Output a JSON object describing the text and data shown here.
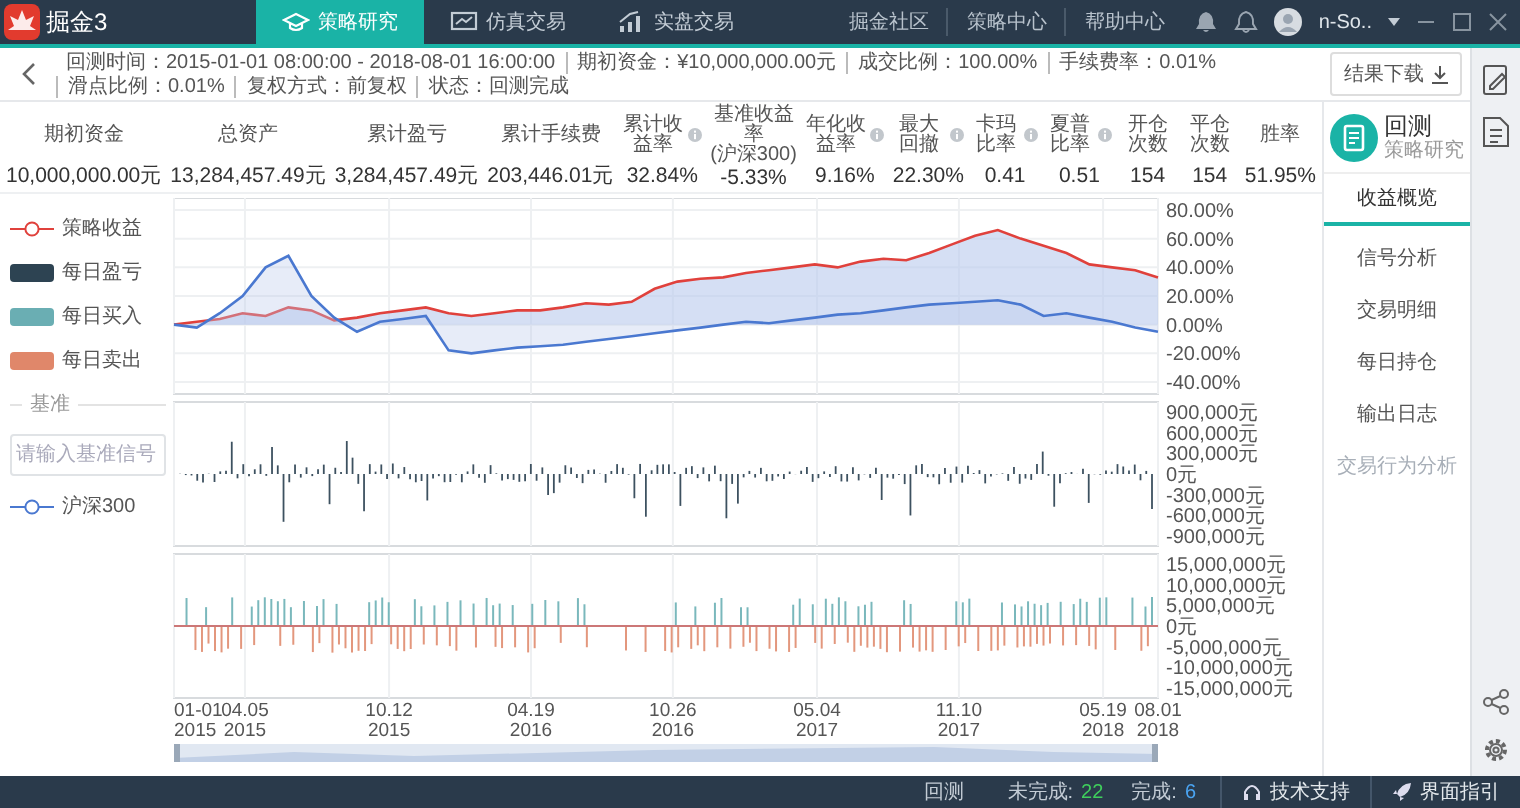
{
  "app": {
    "name": "掘金3"
  },
  "nav_tabs": [
    {
      "label": "策略研究",
      "selected": true
    },
    {
      "label": "仿真交易",
      "selected": false
    },
    {
      "label": "实盘交易",
      "selected": false
    }
  ],
  "header_links": [
    "掘金社区",
    "策略中心",
    "帮助中心"
  ],
  "user": {
    "name": "n-So.."
  },
  "info_bar": {
    "items": [
      "回测时间：2015-01-01 08:00:00 - 2018-08-01 16:00:00",
      "期初资金：¥10,000,000.00元",
      "成交比例：100.00%",
      "手续费率：0.01%",
      "滑点比例：0.01%",
      "复权方式：前复权",
      "状态：回测完成"
    ],
    "download_button": "结果下载"
  },
  "stats": [
    {
      "label": "期初资金",
      "value": "10,000,000.00元",
      "info": false
    },
    {
      "label": "总资产",
      "value": "13,284,457.49元",
      "info": false
    },
    {
      "label": "累计盈亏",
      "value": "3,284,457.49元",
      "info": false
    },
    {
      "label": "累计手续费",
      "value": "203,446.01元",
      "info": false
    },
    {
      "label": "累计收益率",
      "value": "32.84%",
      "info": true
    },
    {
      "label": "基准收益率",
      "sublabel": "(沪深300)",
      "value": "-5.33%",
      "info": false
    },
    {
      "label": "年化收益率",
      "value": "9.16%",
      "info": true
    },
    {
      "label": "最大回撤",
      "value": "22.30%",
      "info": true
    },
    {
      "label": "卡玛比率",
      "value": "0.41",
      "info": true
    },
    {
      "label": "夏普比率",
      "value": "0.51",
      "info": true
    },
    {
      "label": "开仓次数",
      "value": "154",
      "info": false
    },
    {
      "label": "平仓次数",
      "value": "154",
      "info": false
    },
    {
      "label": "胜率",
      "value": "51.95%",
      "info": false
    }
  ],
  "legend": {
    "items": [
      {
        "kind": "line",
        "label": "策略收益",
        "color": "#e0413c"
      },
      {
        "kind": "swatch",
        "label": "每日盈亏",
        "color": "#2d4352"
      },
      {
        "kind": "swatch",
        "label": "每日买入",
        "color": "#6aaeb3"
      },
      {
        "kind": "swatch",
        "label": "每日卖出",
        "color": "#e0876a"
      }
    ],
    "benchmark_heading": "基准",
    "benchmark_placeholder": "请输入基准信号",
    "benchmark_items": [
      {
        "kind": "line",
        "label": "沪深300",
        "color": "#4a78d0"
      }
    ]
  },
  "charts": {
    "returns": {
      "chart_data": {
        "type": "line",
        "ylim": [
          -40,
          80
        ],
        "grid": true,
        "yticks": [
          {
            "value": 80,
            "label": "80.00%"
          },
          {
            "value": 60,
            "label": "60.00%"
          },
          {
            "value": 40,
            "label": "40.00%"
          },
          {
            "value": 20,
            "label": "20.00%"
          },
          {
            "value": 0,
            "label": "0.00%"
          },
          {
            "value": -20,
            "label": "-20.00%"
          },
          {
            "value": -40,
            "label": "-40.00%"
          }
        ],
        "series": [
          {
            "color": "#e0413c",
            "values": [
              0,
              2,
              4,
              8,
              6,
              12,
              10,
              3,
              5,
              8,
              10,
              12,
              8,
              6,
              8,
              10,
              10,
              12,
              15,
              14,
              16,
              25,
              30,
              32,
              33,
              36,
              38,
              40,
              42,
              40,
              44,
              46,
              45,
              50,
              56,
              62,
              66,
              60,
              55,
              50,
              42,
              40,
              38,
              33
            ]
          },
          {
            "color": "#4a78d0",
            "values": [
              0,
              -2,
              8,
              20,
              40,
              48,
              20,
              5,
              -5,
              2,
              4,
              6,
              -18,
              -20,
              -18,
              -16,
              -15,
              -14,
              -12,
              -10,
              -8,
              -6,
              -4,
              -2,
              0,
              2,
              1,
              3,
              5,
              7,
              8,
              10,
              12,
              14,
              15,
              16,
              17,
              14,
              6,
              8,
              5,
              2,
              -2,
              -5
            ]
          }
        ]
      }
    },
    "pnl": {
      "yticks": [
        "900,000元",
        "600,000元",
        "300,000元",
        "0元",
        "-300,000元",
        "-600,000元",
        "-900,000元"
      ]
    },
    "trades": {
      "yticks": [
        "15,000,000元",
        "10,000,000元",
        "5,000,000元",
        "0元",
        "-5,000,000元",
        "-10,000,000元",
        "-15,000,000元"
      ]
    },
    "x_axis": [
      {
        "date": "01-01",
        "year": "2015"
      },
      {
        "date": "04.05",
        "year": "2015"
      },
      {
        "date": "10.12",
        "year": "2015"
      },
      {
        "date": "04.19",
        "year": "2016"
      },
      {
        "date": "10.26",
        "year": "2016"
      },
      {
        "date": "05.04",
        "year": "2017"
      },
      {
        "date": "11.10",
        "year": "2017"
      },
      {
        "date": "05.19",
        "year": "2018"
      },
      {
        "date": "08.01",
        "year": "2018"
      }
    ]
  },
  "side_panel": {
    "title": "回测",
    "subtitle": "策略研究",
    "tabs": [
      {
        "label": "收益概览",
        "selected": true,
        "disabled": false
      },
      {
        "label": "信号分析",
        "selected": false,
        "disabled": false
      },
      {
        "label": "交易明细",
        "selected": false,
        "disabled": false
      },
      {
        "label": "每日持仓",
        "selected": false,
        "disabled": false
      },
      {
        "label": "输出日志",
        "selected": false,
        "disabled": false
      },
      {
        "label": "交易行为分析",
        "selected": false,
        "disabled": true
      }
    ]
  },
  "status_bar": {
    "label": "回测",
    "pending_label": "未完成:",
    "pending": "22",
    "done_label": "完成:",
    "done": "6",
    "support": "技术支持",
    "guide": "界面指引"
  }
}
